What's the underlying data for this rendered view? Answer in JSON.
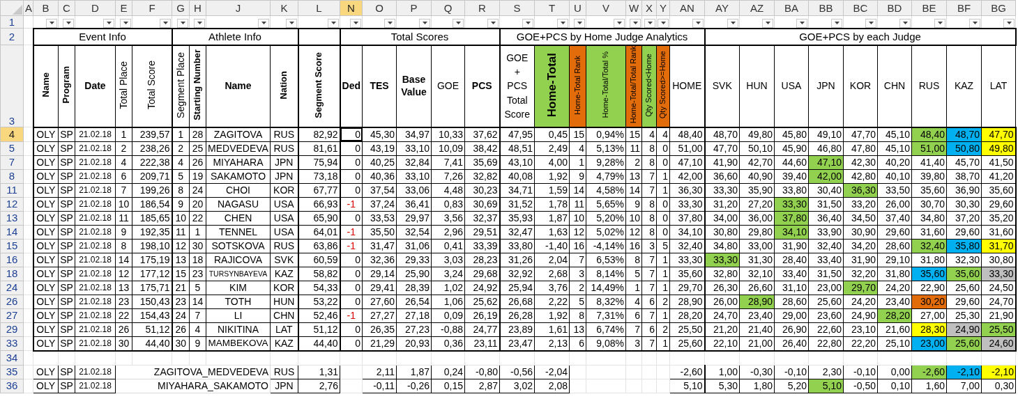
{
  "columns": [
    {
      "letter": "A",
      "selected": false,
      "filter": false
    },
    {
      "letter": "B",
      "selected": false,
      "filter": true
    },
    {
      "letter": "C",
      "selected": false,
      "filter": true
    },
    {
      "letter": "D",
      "selected": false,
      "filter": true
    },
    {
      "letter": "E",
      "selected": false,
      "filter": true
    },
    {
      "letter": "F",
      "selected": false,
      "filter": true
    },
    {
      "letter": "G",
      "selected": false,
      "filter": true
    },
    {
      "letter": "H",
      "selected": false,
      "filter": true
    },
    {
      "letter": "J",
      "selected": false,
      "filter": true
    },
    {
      "letter": "K",
      "selected": false,
      "filter": true
    },
    {
      "letter": "L",
      "selected": false,
      "filter": true
    },
    {
      "letter": "N",
      "selected": true,
      "filter": true
    },
    {
      "letter": "O",
      "selected": false,
      "filter": true
    },
    {
      "letter": "P",
      "selected": false,
      "filter": true
    },
    {
      "letter": "Q",
      "selected": false,
      "filter": true
    },
    {
      "letter": "R",
      "selected": false,
      "filter": true
    },
    {
      "letter": "S",
      "selected": false,
      "filter": true
    },
    {
      "letter": "T",
      "selected": false,
      "filter": true
    },
    {
      "letter": "U",
      "selected": false,
      "filter": true
    },
    {
      "letter": "V",
      "selected": false,
      "filter": true
    },
    {
      "letter": "W",
      "selected": false,
      "filter": true
    },
    {
      "letter": "X",
      "selected": false,
      "filter": true
    },
    {
      "letter": "Y",
      "selected": false,
      "filter": true
    },
    {
      "letter": "AN",
      "selected": false,
      "filter": true
    },
    {
      "letter": "AY",
      "selected": false,
      "filter": true
    },
    {
      "letter": "AZ",
      "selected": false,
      "filter": true
    },
    {
      "letter": "BA",
      "selected": false,
      "filter": true
    },
    {
      "letter": "BB",
      "selected": false,
      "filter": true
    },
    {
      "letter": "BC",
      "selected": false,
      "filter": true
    },
    {
      "letter": "BD",
      "selected": false,
      "filter": true
    },
    {
      "letter": "BE",
      "selected": false,
      "filter": true
    },
    {
      "letter": "BF",
      "selected": false,
      "filter": true
    },
    {
      "letter": "BG",
      "selected": false,
      "filter": true
    }
  ],
  "filter_row": "1",
  "group_row": "2",
  "header_row": "3",
  "empty_row": "34",
  "groups": [
    {
      "label": "Event Info"
    },
    {
      "label": "Athlete Info"
    },
    {
      "label": "Total Scores"
    },
    {
      "label": "GOE+PCS by Home Judge Analytics"
    },
    {
      "label": "GOE+PCS by each Judge"
    }
  ],
  "headers": [
    {
      "label": "Name"
    },
    {
      "label": "Program"
    },
    {
      "label": "Date"
    },
    {
      "label": "Total Place"
    },
    {
      "label": "Total Score"
    },
    {
      "label": "Segment Place"
    },
    {
      "label": "Starting Number"
    },
    {
      "label": "Name"
    },
    {
      "label": "Nation"
    },
    {
      "label": "Segment Score"
    },
    {
      "label": "Ded"
    },
    {
      "label": "TES"
    },
    {
      "label": "Base Value"
    },
    {
      "label": "GOE"
    },
    {
      "label": "PCS"
    },
    {
      "label": "GOE + PCS Total Score"
    },
    {
      "label": "Home-Total",
      "color": "#92d050"
    },
    {
      "label": "Home-Total Rank",
      "color": "#e26b0a"
    },
    {
      "label": "Home-Total/Total %",
      "color": "#92d050"
    },
    {
      "label": "Home-Total/Total Rank",
      "color": "#e26b0a"
    },
    {
      "label": "Qty Scored<Home",
      "color": "#92d050"
    },
    {
      "label": "Qty Scored>=Home",
      "color": "#e26b0a"
    },
    {
      "label": "HOME"
    },
    {
      "label": "SVK"
    },
    {
      "label": "HUN"
    },
    {
      "label": "USA"
    },
    {
      "label": "JPN"
    },
    {
      "label": "KOR"
    },
    {
      "label": "CHN"
    },
    {
      "label": "RUS"
    },
    {
      "label": "KAZ"
    },
    {
      "label": "LAT"
    }
  ],
  "rows": [
    {
      "row": "4",
      "selected": true,
      "penalty": false,
      "cells": [
        "OLY",
        "SP",
        "21.02.18",
        "1",
        "239,57",
        "1",
        "28",
        "ZAGITOVA",
        "RUS",
        "82,92",
        "0",
        "45,30",
        "34,97",
        "10,33",
        "37,62",
        "47,95",
        "0,45",
        "15",
        "0,94%",
        "15",
        "4",
        "4",
        "48,40"
      ],
      "judges": [
        {
          "value": "48,70"
        },
        {
          "value": "49,80"
        },
        {
          "value": "45,80"
        },
        {
          "value": "49,10"
        },
        {
          "value": "47,70"
        },
        {
          "value": "45,10"
        },
        {
          "value": "48,40",
          "color": "#92d050"
        },
        {
          "value": "48,70",
          "color": "#00b0f0"
        },
        {
          "value": "47,70",
          "color": "#ffff00"
        }
      ]
    },
    {
      "row": "5",
      "selected": false,
      "penalty": false,
      "cells": [
        "OLY",
        "SP",
        "21.02.18",
        "2",
        "238,26",
        "2",
        "25",
        "MEDVEDEVA",
        "RUS",
        "81,61",
        "0",
        "43,19",
        "33,10",
        "10,09",
        "38,42",
        "48,51",
        "2,49",
        "4",
        "5,13%",
        "11",
        "8",
        "0",
        "51,00"
      ],
      "judges": [
        {
          "value": "47,70"
        },
        {
          "value": "50,10"
        },
        {
          "value": "45,90"
        },
        {
          "value": "46,80"
        },
        {
          "value": "47,80"
        },
        {
          "value": "45,10"
        },
        {
          "value": "51,00",
          "color": "#92d050"
        },
        {
          "value": "50,80",
          "color": "#00b0f0"
        },
        {
          "value": "49,80",
          "color": "#ffff00"
        }
      ]
    },
    {
      "row": "7",
      "selected": false,
      "penalty": false,
      "cells": [
        "OLY",
        "SP",
        "21.02.18",
        "4",
        "222,38",
        "4",
        "26",
        "MIYAHARA",
        "JPN",
        "75,94",
        "0",
        "40,25",
        "32,84",
        "7,41",
        "35,69",
        "43,10",
        "4,00",
        "1",
        "9,28%",
        "2",
        "8",
        "0",
        "47,10"
      ],
      "judges": [
        {
          "value": "41,90"
        },
        {
          "value": "42,70"
        },
        {
          "value": "44,60"
        },
        {
          "value": "47,10",
          "color": "#92d050"
        },
        {
          "value": "42,30"
        },
        {
          "value": "40,20"
        },
        {
          "value": "41,40"
        },
        {
          "value": "45,70"
        },
        {
          "value": "41,50"
        }
      ]
    },
    {
      "row": "8",
      "selected": false,
      "penalty": false,
      "cells": [
        "OLY",
        "SP",
        "21.02.18",
        "6",
        "209,71",
        "5",
        "19",
        "SAKAMOTO",
        "JPN",
        "73,18",
        "0",
        "40,36",
        "33,10",
        "7,26",
        "32,82",
        "40,08",
        "1,92",
        "9",
        "4,79%",
        "13",
        "7",
        "1",
        "42,00"
      ],
      "judges": [
        {
          "value": "36,60"
        },
        {
          "value": "40,90"
        },
        {
          "value": "39,40"
        },
        {
          "value": "42,00",
          "color": "#92d050"
        },
        {
          "value": "42,80"
        },
        {
          "value": "40,10"
        },
        {
          "value": "39,80"
        },
        {
          "value": "38,70"
        },
        {
          "value": "41,20"
        }
      ]
    },
    {
      "row": "11",
      "selected": false,
      "penalty": false,
      "cells": [
        "OLY",
        "SP",
        "21.02.18",
        "7",
        "199,26",
        "8",
        "24",
        "CHOI",
        "KOR",
        "67,77",
        "0",
        "37,54",
        "33,06",
        "4,48",
        "30,23",
        "34,71",
        "1,59",
        "14",
        "4,58%",
        "14",
        "7",
        "1",
        "36,30"
      ],
      "judges": [
        {
          "value": "33,30"
        },
        {
          "value": "35,90"
        },
        {
          "value": "33,80"
        },
        {
          "value": "30,40"
        },
        {
          "value": "36,30",
          "color": "#92d050"
        },
        {
          "value": "33,50"
        },
        {
          "value": "35,60"
        },
        {
          "value": "36,90"
        },
        {
          "value": "35,60"
        }
      ]
    },
    {
      "row": "12",
      "selected": false,
      "penalty": true,
      "cells": [
        "OLY",
        "SP",
        "21.02.18",
        "10",
        "186,54",
        "9",
        "20",
        "NAGASU",
        "USA",
        "66,93",
        "-1",
        "37,24",
        "36,41",
        "0,83",
        "30,69",
        "31,52",
        "1,78",
        "11",
        "5,65%",
        "9",
        "8",
        "0",
        "33,30"
      ],
      "judges": [
        {
          "value": "31,20"
        },
        {
          "value": "27,20"
        },
        {
          "value": "33,30",
          "color": "#92d050"
        },
        {
          "value": "31,50"
        },
        {
          "value": "33,20"
        },
        {
          "value": "26,00"
        },
        {
          "value": "30,70"
        },
        {
          "value": "30,30"
        },
        {
          "value": "29,60"
        }
      ]
    },
    {
      "row": "13",
      "selected": false,
      "penalty": false,
      "cells": [
        "OLY",
        "SP",
        "21.02.18",
        "11",
        "185,65",
        "10",
        "22",
        "CHEN",
        "USA",
        "65,90",
        "0",
        "33,53",
        "29,97",
        "3,56",
        "32,37",
        "35,93",
        "1,87",
        "10",
        "5,20%",
        "10",
        "8",
        "0",
        "37,80"
      ],
      "judges": [
        {
          "value": "34,00"
        },
        {
          "value": "36,00"
        },
        {
          "value": "37,80",
          "color": "#92d050"
        },
        {
          "value": "36,40"
        },
        {
          "value": "34,50"
        },
        {
          "value": "37,40"
        },
        {
          "value": "34,80"
        },
        {
          "value": "37,20"
        },
        {
          "value": "35,20"
        }
      ]
    },
    {
      "row": "14",
      "selected": false,
      "penalty": true,
      "cells": [
        "OLY",
        "SP",
        "21.02.18",
        "9",
        "192,35",
        "11",
        "1",
        "TENNEL",
        "USA",
        "64,01",
        "-1",
        "35,50",
        "32,54",
        "2,96",
        "29,51",
        "32,47",
        "1,63",
        "12",
        "5,02%",
        "12",
        "8",
        "0",
        "34,10"
      ],
      "judges": [
        {
          "value": "30,80"
        },
        {
          "value": "29,80"
        },
        {
          "value": "34,10",
          "color": "#92d050"
        },
        {
          "value": "33,90"
        },
        {
          "value": "30,90"
        },
        {
          "value": "29,60"
        },
        {
          "value": "31,60"
        },
        {
          "value": "29,60"
        },
        {
          "value": "31,60"
        }
      ]
    },
    {
      "row": "15",
      "selected": false,
      "penalty": true,
      "cells": [
        "OLY",
        "SP",
        "21.02.18",
        "8",
        "198,10",
        "12",
        "30",
        "SOTSKOVA",
        "RUS",
        "63,86",
        "-1",
        "31,47",
        "31,06",
        "0,41",
        "33,39",
        "33,80",
        "-1,40",
        "16",
        "-4,14%",
        "16",
        "3",
        "5",
        "32,40"
      ],
      "judges": [
        {
          "value": "34,80"
        },
        {
          "value": "33,00"
        },
        {
          "value": "31,90"
        },
        {
          "value": "32,40"
        },
        {
          "value": "34,20"
        },
        {
          "value": "28,60"
        },
        {
          "value": "32,40",
          "color": "#92d050"
        },
        {
          "value": "35,80",
          "color": "#00b0f0"
        },
        {
          "value": "31,70",
          "color": "#ffff00"
        }
      ]
    },
    {
      "row": "16",
      "selected": false,
      "penalty": false,
      "cells": [
        "OLY",
        "SP",
        "21.02.18",
        "14",
        "175,19",
        "13",
        "18",
        "RAJICOVA",
        "SVK",
        "60,59",
        "0",
        "32,36",
        "29,33",
        "3,03",
        "28,23",
        "31,26",
        "2,04",
        "7",
        "6,53%",
        "8",
        "7",
        "1",
        "33,30"
      ],
      "judges": [
        {
          "value": "33,30",
          "color": "#92d050"
        },
        {
          "value": "31,30"
        },
        {
          "value": "28,40"
        },
        {
          "value": "33,40"
        },
        {
          "value": "31,90"
        },
        {
          "value": "29,10"
        },
        {
          "value": "31,80"
        },
        {
          "value": "32,30"
        },
        {
          "value": "30,80"
        }
      ]
    },
    {
      "row": "18",
      "selected": false,
      "penalty": false,
      "cells": [
        "OLY",
        "SP",
        "21.02.18",
        "12",
        "177,12",
        "15",
        "23",
        "TURSYNBAYEVA",
        "KAZ",
        "58,82",
        "0",
        "29,14",
        "25,90",
        "3,24",
        "29,68",
        "32,92",
        "2,68",
        "3",
        "8,14%",
        "5",
        "7",
        "1",
        "35,60"
      ],
      "judges": [
        {
          "value": "32,80"
        },
        {
          "value": "32,10"
        },
        {
          "value": "33,40"
        },
        {
          "value": "31,50"
        },
        {
          "value": "32,20"
        },
        {
          "value": "31,80"
        },
        {
          "value": "35,60",
          "color": "#00b0f0"
        },
        {
          "value": "35,60",
          "color": "#92d050"
        },
        {
          "value": "33,30",
          "color": "#bfbfbf"
        }
      ]
    },
    {
      "row": "24",
      "selected": false,
      "penalty": false,
      "cells": [
        "OLY",
        "SP",
        "21.02.18",
        "13",
        "175,71",
        "21",
        "5",
        "KIM",
        "KOR",
        "54,33",
        "0",
        "29,41",
        "28,39",
        "1,02",
        "24,92",
        "25,94",
        "3,76",
        "2",
        "14,49%",
        "1",
        "7",
        "1",
        "29,70"
      ],
      "judges": [
        {
          "value": "26,30"
        },
        {
          "value": "26,60"
        },
        {
          "value": "31,10"
        },
        {
          "value": "23,00"
        },
        {
          "value": "29,70",
          "color": "#92d050"
        },
        {
          "value": "24,20"
        },
        {
          "value": "22,90"
        },
        {
          "value": "25,60"
        },
        {
          "value": "24,50"
        }
      ]
    },
    {
      "row": "26",
      "selected": false,
      "penalty": false,
      "cells": [
        "OLY",
        "SP",
        "21.02.18",
        "23",
        "150,43",
        "23",
        "14",
        "TOTH",
        "HUN",
        "53,22",
        "0",
        "27,60",
        "26,54",
        "1,06",
        "25,62",
        "26,68",
        "2,22",
        "5",
        "8,32%",
        "4",
        "6",
        "2",
        "28,90"
      ],
      "judges": [
        {
          "value": "26,00"
        },
        {
          "value": "28,90",
          "color": "#92d050"
        },
        {
          "value": "28,60"
        },
        {
          "value": "25,60"
        },
        {
          "value": "24,20"
        },
        {
          "value": "23,40"
        },
        {
          "value": "30,20",
          "color": "#e26b0a"
        },
        {
          "value": "29,60"
        },
        {
          "value": "24,70"
        }
      ]
    },
    {
      "row": "27",
      "selected": false,
      "penalty": true,
      "cells": [
        "OLY",
        "SP",
        "21.02.18",
        "22",
        "154,43",
        "24",
        "7",
        "LI",
        "CHN",
        "52,46",
        "-1",
        "27,27",
        "27,18",
        "0,09",
        "26,19",
        "26,28",
        "1,92",
        "8",
        "7,31%",
        "6",
        "7",
        "1",
        "28,20"
      ],
      "judges": [
        {
          "value": "24,70"
        },
        {
          "value": "23,40"
        },
        {
          "value": "29,00"
        },
        {
          "value": "23,60"
        },
        {
          "value": "24,90"
        },
        {
          "value": "28,20",
          "color": "#92d050"
        },
        {
          "value": "27,00"
        },
        {
          "value": "25,30"
        },
        {
          "value": "21,90"
        }
      ]
    },
    {
      "row": "29",
      "selected": false,
      "penalty": false,
      "cells": [
        "OLY",
        "SP",
        "21.02.18",
        "26",
        "51,12",
        "26",
        "4",
        "NIKITINA",
        "LAT",
        "51,12",
        "0",
        "26,35",
        "27,23",
        "-0,88",
        "24,77",
        "23,89",
        "1,61",
        "13",
        "6,74%",
        "7",
        "6",
        "2",
        "25,50"
      ],
      "judges": [
        {
          "value": "21,20"
        },
        {
          "value": "21,40"
        },
        {
          "value": "26,90"
        },
        {
          "value": "22,60"
        },
        {
          "value": "23,10"
        },
        {
          "value": "21,60"
        },
        {
          "value": "28,30",
          "color": "#ffff00"
        },
        {
          "value": "24,90",
          "color": "#bfbfbf"
        },
        {
          "value": "25,50",
          "color": "#92d050"
        }
      ]
    },
    {
      "row": "33",
      "selected": false,
      "penalty": false,
      "cells": [
        "OLY",
        "SP",
        "21.02.18",
        "30",
        "44,40",
        "30",
        "9",
        "MAMBEKOVA",
        "KAZ",
        "44,40",
        "0",
        "21,29",
        "20,93",
        "0,36",
        "23,11",
        "23,47",
        "2,13",
        "6",
        "9,08%",
        "3",
        "7",
        "1",
        "25,60"
      ],
      "judges": [
        {
          "value": "22,10"
        },
        {
          "value": "21,00"
        },
        {
          "value": "26,40"
        },
        {
          "value": "22,80"
        },
        {
          "value": "22,20"
        },
        {
          "value": "25,10"
        },
        {
          "value": "23,00",
          "color": "#00b0f0"
        },
        {
          "value": "25,60",
          "color": "#92d050"
        },
        {
          "value": "24,60",
          "color": "#bfbfbf"
        }
      ]
    }
  ],
  "summary_rows": [
    {
      "row": "35",
      "event": "OLY",
      "program": "SP",
      "date": "21.02.18",
      "name": "ZAGITOVA_MEDVEDEVA",
      "nation": "RUS",
      "segment_score": "1,31",
      "scores": [
        "2,11",
        "1,87",
        "0,24",
        "-0,80",
        "-0,56",
        "-2,04"
      ],
      "home": "-2,60",
      "judges": [
        {
          "value": "1,00"
        },
        {
          "value": "-0,30"
        },
        {
          "value": "-0,10"
        },
        {
          "value": "2,30"
        },
        {
          "value": "-0,10"
        },
        {
          "value": "0,00"
        },
        {
          "value": "-2,60",
          "color": "#92d050"
        },
        {
          "value": "-2,10",
          "color": "#00b0f0"
        },
        {
          "value": "-2,10",
          "color": "#ffff00"
        }
      ]
    },
    {
      "row": "36",
      "event": "OLY",
      "program": "SP",
      "date": "21.02.18",
      "name": "MIYAHARA_SAKAMOTO",
      "nation": "JPN",
      "segment_score": "2,76",
      "scores": [
        "-0,11",
        "-0,26",
        "0,15",
        "2,87",
        "3,02",
        "2,08"
      ],
      "home": "5,10",
      "judges": [
        {
          "value": "5,30"
        },
        {
          "value": "1,80"
        },
        {
          "value": "5,20"
        },
        {
          "value": "5,10",
          "color": "#92d050"
        },
        {
          "value": "-0,50"
        },
        {
          "value": "0,10"
        },
        {
          "value": "1,60"
        },
        {
          "value": "7,00"
        },
        {
          "value": "0,30"
        }
      ]
    }
  ]
}
